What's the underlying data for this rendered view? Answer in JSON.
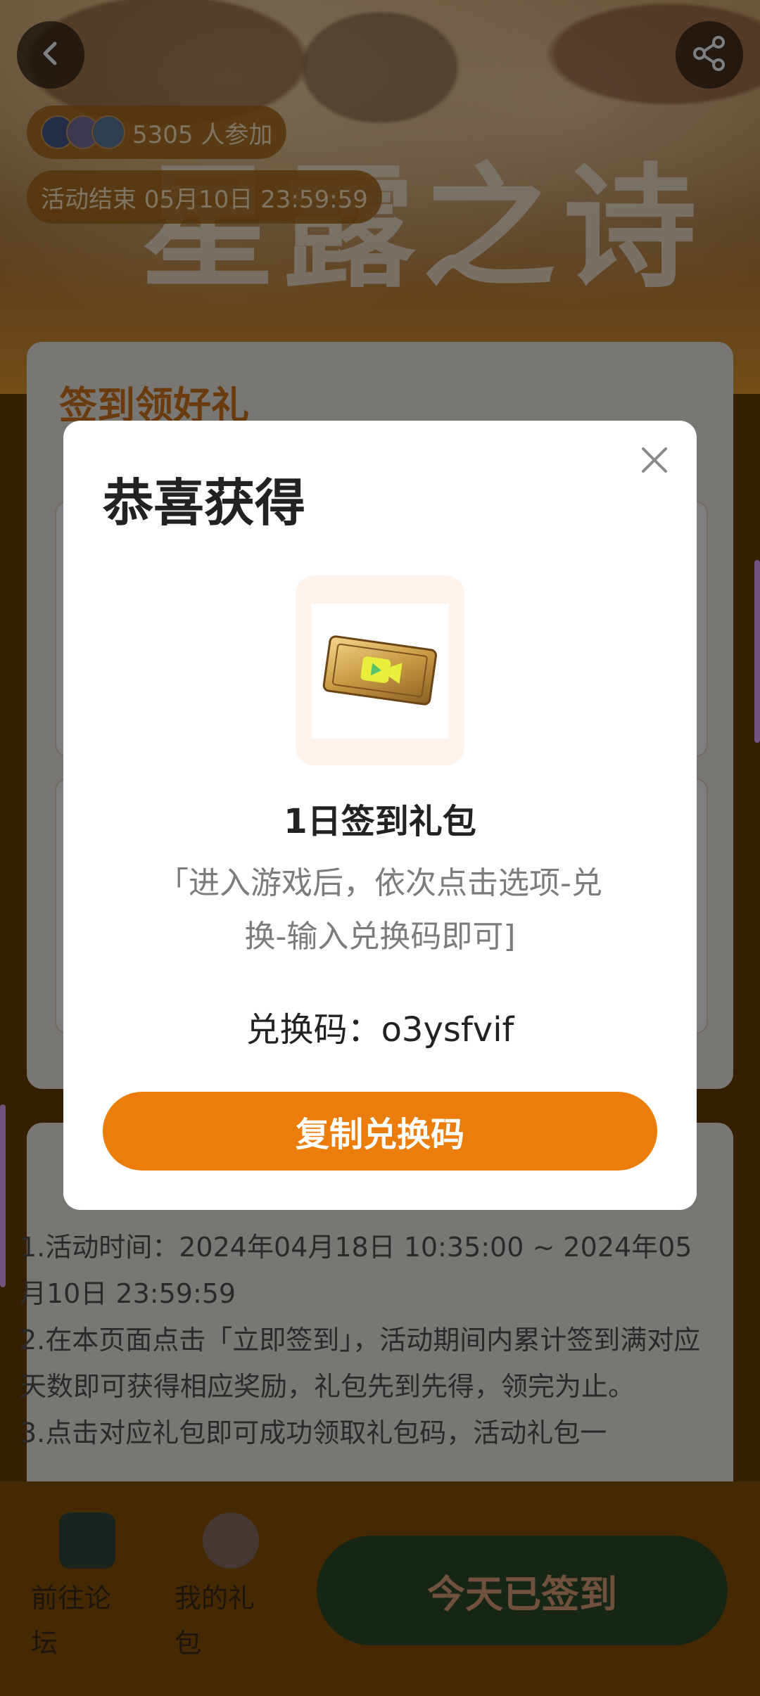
{
  "header": {
    "participants": "5305 人参加",
    "end_time": "活动结束 05月10日 23:59:59",
    "banner_title": "星露之诗"
  },
  "checkin_card": {
    "title": "签到领好礼"
  },
  "rules": {
    "lines": [
      "1.活动时间：2024年04月18日 10:35:00 ~ 2024年05月10日 23:59:59",
      "2.在本页面点击「立即签到」，活动期间内累计签到满对应天数即可获得相应奖励，礼包先到先得，领完为止。",
      "3.点击对应礼包即可成功领取礼包码，活动礼包一"
    ]
  },
  "bottom_bar": {
    "forum_label": "前往论坛",
    "gifts_label": "我的礼包",
    "signed_button": "今天已签到"
  },
  "modal": {
    "title": "恭喜获得",
    "gift_name": "1日签到礼包",
    "description": "「进入游戏后，依次点击选项-兑换-输入兑换码即可]",
    "code_line": "兑换码：o3ysfvif",
    "copy_button": "复制兑换码"
  },
  "colors": {
    "accent": "#ea7d0c",
    "title_orange": "#d2761e",
    "signed_green": "#2f4a2c"
  },
  "icons": {
    "back": "chevron-left-icon",
    "share": "share-icon",
    "close": "close-icon",
    "prize": "video-ticket-icon"
  }
}
